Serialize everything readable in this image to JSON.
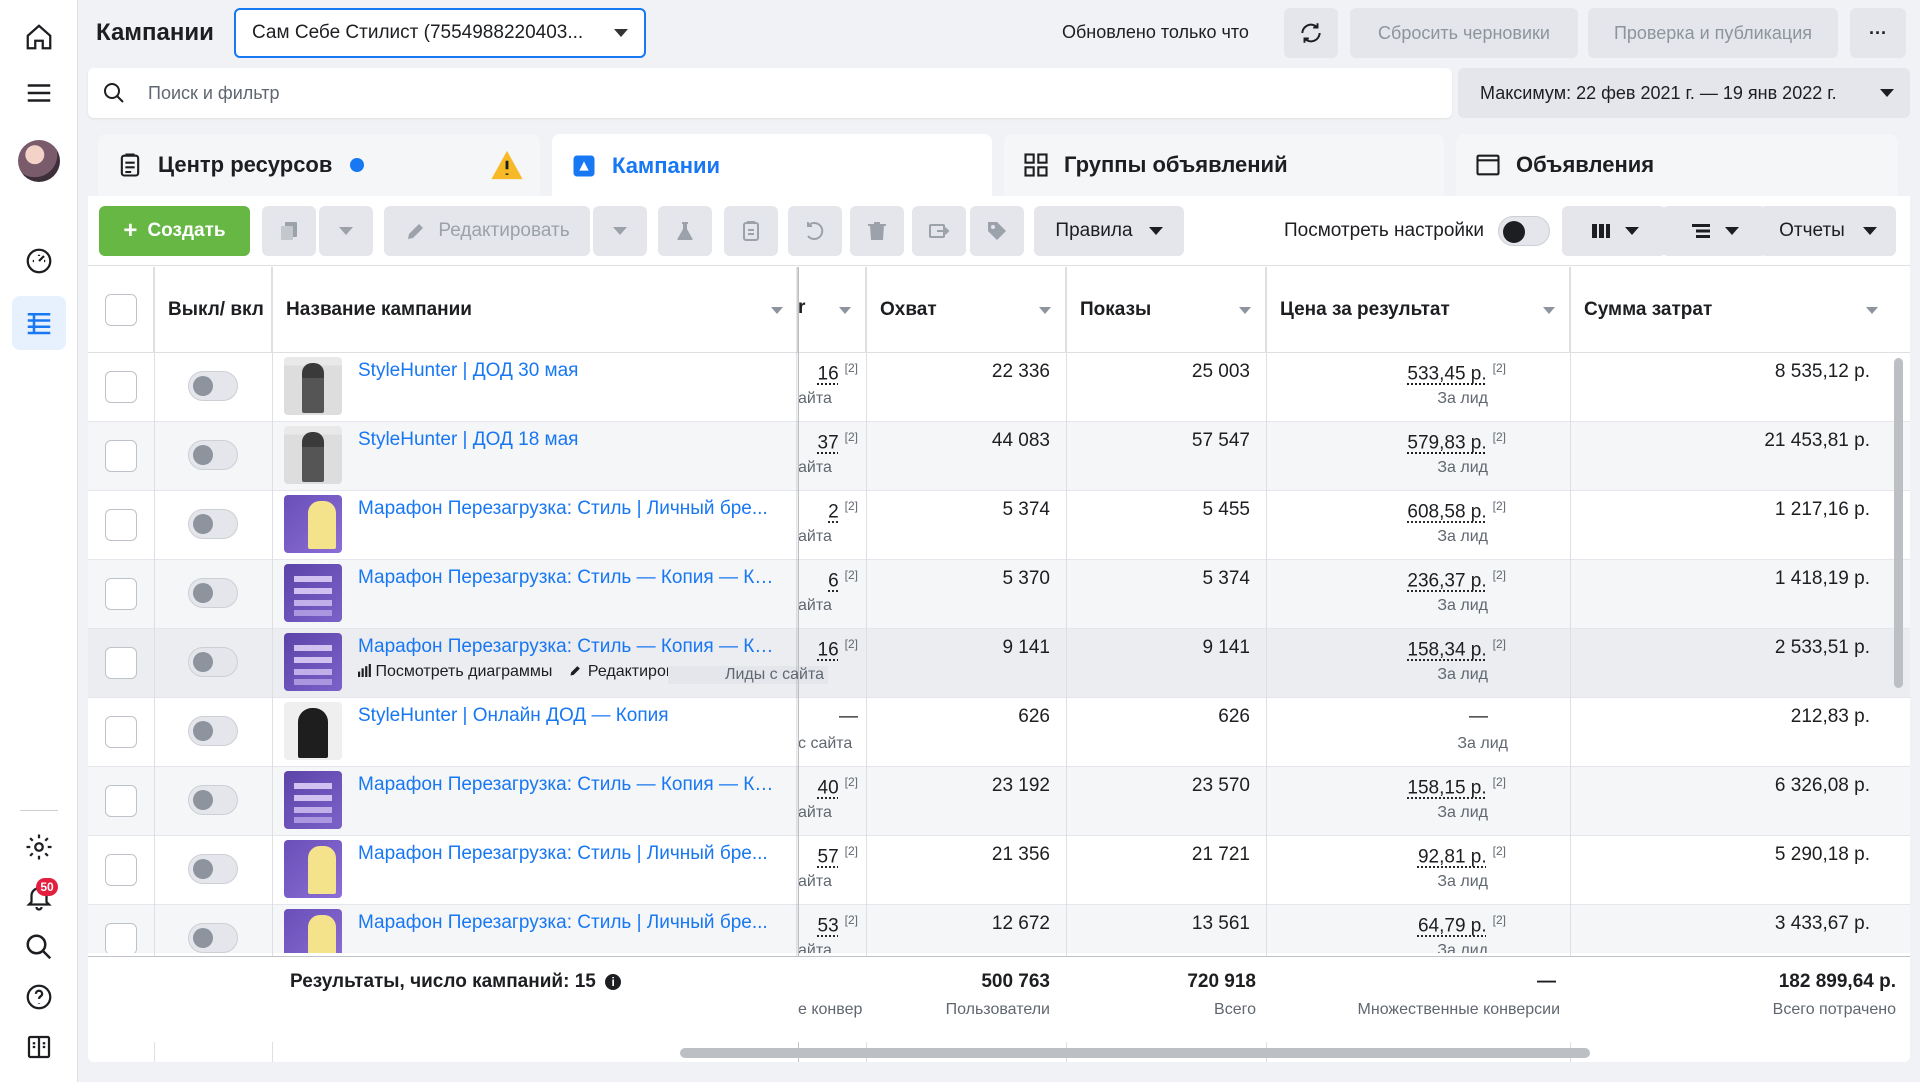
{
  "header": {
    "page_title": "Кампании",
    "account_select": "Сам Себе Стилист (7554988220403...",
    "updated_text": "Обновлено только что",
    "reset_drafts": "Сбросить черновики",
    "review_publish": "Проверка и публикация",
    "more_label": "···"
  },
  "search": {
    "placeholder": "Поиск и фильтр"
  },
  "date_range": "Максимум: 22 фев 2021 г. — 19 янв 2022 г.",
  "tabs": {
    "resources": "Центр ресурсов",
    "campaigns": "Кампании",
    "adsets": "Группы объявлений",
    "ads": "Объявления"
  },
  "toolbar": {
    "create": "Создать",
    "edit": "Редактировать",
    "rules": "Правила",
    "view_settings": "Посмотреть настройки",
    "reports": "Отчеты"
  },
  "columns": {
    "toggle": "Выкл/ вкл",
    "name": "Название кампании",
    "reach": "Охват",
    "impressions": "Показы",
    "cost_per_result": "Цена за результат",
    "amount_spent": "Сумма затрат"
  },
  "hover_actions": {
    "charts": "Посмотреть диаграммы",
    "edit": "Редактировать"
  },
  "rows": [
    {
      "name": "StyleHunter | ДОД 30 мая",
      "thumb": "person",
      "results": "16",
      "results_sub": "айта",
      "reach": "22 336",
      "impressions": "25 003",
      "cpr": "533,45 р.",
      "cpr_sub": "За лид",
      "spent": "8 535,12 р."
    },
    {
      "name": "StyleHunter | ДОД 18 мая",
      "thumb": "person",
      "results": "37",
      "results_sub": "айта",
      "reach": "44 083",
      "impressions": "57 547",
      "cpr": "579,83 р.",
      "cpr_sub": "За лид",
      "spent": "21 453,81 р."
    },
    {
      "name": "Марафон Перезагрузка: Стиль | Личный бре...",
      "thumb": "purple",
      "results": "2",
      "results_sub": "айта",
      "reach": "5 374",
      "impressions": "5 455",
      "cpr": "608,58 р.",
      "cpr_sub": "За лид",
      "spent": "1 217,16 р."
    },
    {
      "name": "Марафон Перезагрузка: Стиль — Копия — Ко...",
      "thumb": "purple2",
      "results": "6",
      "results_sub": "айта",
      "reach": "5 370",
      "impressions": "5 374",
      "cpr": "236,37 р.",
      "cpr_sub": "За лид",
      "spent": "1 418,19 р."
    },
    {
      "name": "Марафон Перезагрузка: Стиль — Копия — Ко...",
      "thumb": "purple2",
      "results": "16",
      "results_sub": "Лиды с сайта",
      "reach": "9 141",
      "impressions": "9 141",
      "cpr": "158,34 р.",
      "cpr_sub": "За лид",
      "spent": "2 533,51 р."
    },
    {
      "name": "StyleHunter | Онлайн ДОД — Копия",
      "thumb": "dark",
      "results": "—",
      "results_sub": "с сайта",
      "reach": "626",
      "impressions": "626",
      "cpr": "—",
      "cpr_sub": "За лид",
      "spent": "212,83 р."
    },
    {
      "name": "Марафон Перезагрузка: Стиль — Копия — Ко...",
      "thumb": "purple2",
      "results": "40",
      "results_sub": "айта",
      "reach": "23 192",
      "impressions": "23 570",
      "cpr": "158,15 р.",
      "cpr_sub": "За лид",
      "spent": "6 326,08 р."
    },
    {
      "name": "Марафон Перезагрузка: Стиль | Личный бре...",
      "thumb": "purple",
      "results": "57",
      "results_sub": "айта",
      "reach": "21 356",
      "impressions": "21 721",
      "cpr": "92,81 р.",
      "cpr_sub": "За лид",
      "spent": "5 290,18 р."
    },
    {
      "name": "Марафон Перезагрузка: Стиль | Личный бре...",
      "thumb": "purple",
      "results": "53",
      "results_sub": "айта",
      "reach": "12 672",
      "impressions": "13 561",
      "cpr": "64,79 р.",
      "cpr_sub": "За лид",
      "spent": "3 433,67 р."
    }
  ],
  "footer": {
    "summary": "Результаты, число кампаний: 15",
    "results_sub": "е конвер",
    "reach_total": "500 763",
    "reach_sub": "Пользователи",
    "impr_total": "720 918",
    "impr_sub": "Всего",
    "cpr_total": "—",
    "cpr_sub": "Множественные конверсии",
    "spent_total": "182 899,64 р.",
    "spent_sub": "Всего потрачено"
  },
  "sup_mark": "[2]",
  "notifications_count": "50",
  "colors": {
    "accent": "#1877f2",
    "create": "#67b744",
    "badge": "#e41e3f"
  }
}
